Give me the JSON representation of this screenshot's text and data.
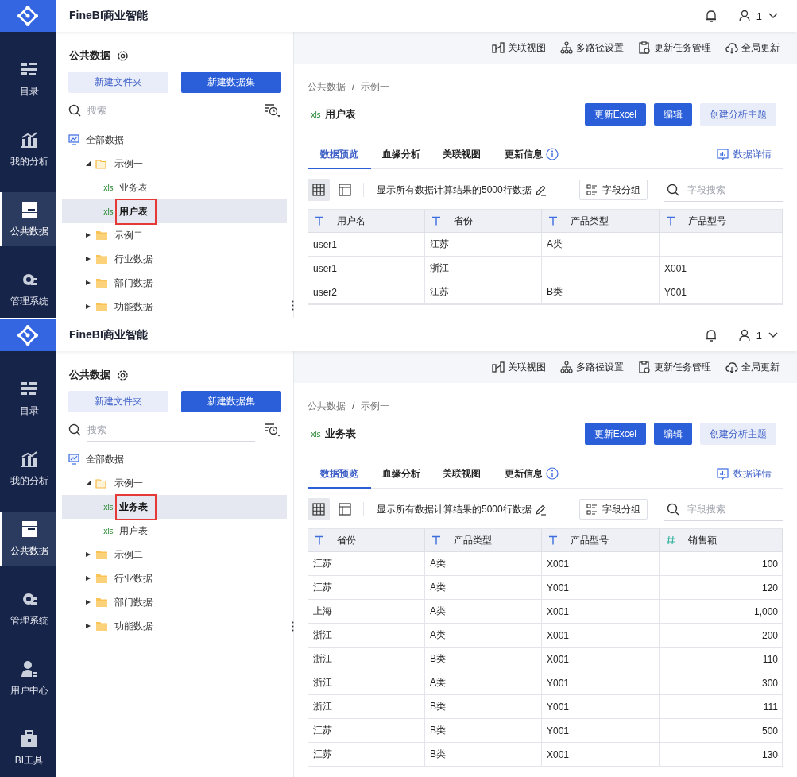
{
  "screens": [
    {
      "app": {
        "title": "FineBI商业智能",
        "user": "1"
      },
      "nav": [
        {
          "label": "目录",
          "kind": "catalog",
          "selected": false
        },
        {
          "label": "我的分析",
          "kind": "analysis",
          "selected": false
        },
        {
          "label": "公共数据",
          "kind": "public",
          "selected": true
        },
        {
          "label": "管理系统",
          "kind": "admin",
          "selected": false
        }
      ],
      "panel": {
        "title": "公共数据",
        "buttons": [
          {
            "label": "新建文件夹",
            "kind": "secondary"
          },
          {
            "label": "新建数据集",
            "kind": "primary"
          }
        ],
        "search": {
          "placeholder": "搜索"
        }
      },
      "tree": [
        {
          "label": "全部数据",
          "kind": "root",
          "children": [
            {
              "label": "示例一",
              "kind": "folder",
              "expanded": true,
              "children": [
                {
                  "label": "业务表",
                  "kind": "table",
                  "badge": "xls",
                  "selected": false
                },
                {
                  "label": "用户表",
                  "kind": "table",
                  "badge": "xls",
                  "selected": true
                }
              ]
            },
            {
              "label": "示例二",
              "kind": "folder",
              "expanded": false
            },
            {
              "label": "行业数据",
              "kind": "folder",
              "expanded": false
            },
            {
              "label": "部门数据",
              "kind": "folder",
              "expanded": false
            },
            {
              "label": "功能数据",
              "kind": "folder",
              "expanded": false
            }
          ]
        }
      ],
      "toolbar": [
        {
          "label": "关联视图",
          "kind": "relation"
        },
        {
          "label": "多路径设置",
          "kind": "paths"
        },
        {
          "label": "更新任务管理",
          "kind": "tasks"
        },
        {
          "label": "全局更新",
          "kind": "cloud"
        }
      ],
      "breadcrumb": {
        "items": [
          "公共数据",
          "示例一"
        ],
        "separator": "/"
      },
      "dataset": {
        "badge": "xls",
        "name": "用户表"
      },
      "actions": [
        {
          "label": "更新Excel",
          "kind": "primary"
        },
        {
          "label": "编辑",
          "kind": "primary"
        },
        {
          "label": "创建分析主题",
          "kind": "secondary"
        }
      ],
      "tabs": [
        {
          "label": "数据预览",
          "selected": true,
          "info": false
        },
        {
          "label": "血缘分析",
          "selected": false,
          "info": false
        },
        {
          "label": "关联视图",
          "selected": false,
          "info": false
        },
        {
          "label": "更新信息",
          "selected": false,
          "info": true
        }
      ],
      "detail_link": "数据详情",
      "view_modes": [
        {
          "kind": "grid",
          "selected": true
        },
        {
          "kind": "layout",
          "selected": false
        }
      ],
      "row_info": "显示所有数据计算结果的5000行数据",
      "group_button": "字段分组",
      "field_search": {
        "placeholder": "字段搜索"
      },
      "table": {
        "columns": [
          {
            "label": "用户名",
            "kind": "text"
          },
          {
            "label": "省份",
            "kind": "text"
          },
          {
            "label": "产品类型",
            "kind": "text"
          },
          {
            "label": "产品型号",
            "kind": "text"
          }
        ],
        "rows": [
          [
            "user1",
            "江苏",
            "A类",
            null
          ],
          [
            "user1",
            "浙江",
            null,
            "X001"
          ],
          [
            "user2",
            "江苏",
            "B类",
            "Y001"
          ]
        ]
      }
    },
    {
      "app": {
        "title": "FineBI商业智能",
        "user": "1"
      },
      "nav": [
        {
          "label": "目录",
          "kind": "catalog",
          "selected": false
        },
        {
          "label": "我的分析",
          "kind": "analysis",
          "selected": false
        },
        {
          "label": "公共数据",
          "kind": "public",
          "selected": true
        },
        {
          "label": "管理系统",
          "kind": "admin",
          "selected": false
        },
        {
          "label": "用户中心",
          "kind": "user",
          "selected": false
        },
        {
          "label": "BI工具",
          "kind": "tools",
          "selected": false
        }
      ],
      "panel": {
        "title": "公共数据",
        "buttons": [
          {
            "label": "新建文件夹",
            "kind": "secondary"
          },
          {
            "label": "新建数据集",
            "kind": "primary"
          }
        ],
        "search": {
          "placeholder": "搜索"
        }
      },
      "tree": [
        {
          "label": "全部数据",
          "kind": "root",
          "children": [
            {
              "label": "示例一",
              "kind": "folder",
              "expanded": true,
              "children": [
                {
                  "label": "业务表",
                  "kind": "table",
                  "badge": "xls",
                  "selected": true
                },
                {
                  "label": "用户表",
                  "kind": "table",
                  "badge": "xls",
                  "selected": false
                }
              ]
            },
            {
              "label": "示例二",
              "kind": "folder",
              "expanded": false
            },
            {
              "label": "行业数据",
              "kind": "folder",
              "expanded": false
            },
            {
              "label": "部门数据",
              "kind": "folder",
              "expanded": false
            },
            {
              "label": "功能数据",
              "kind": "folder",
              "expanded": false
            }
          ]
        }
      ],
      "toolbar": [
        {
          "label": "关联视图",
          "kind": "relation"
        },
        {
          "label": "多路径设置",
          "kind": "paths"
        },
        {
          "label": "更新任务管理",
          "kind": "tasks"
        },
        {
          "label": "全局更新",
          "kind": "cloud"
        }
      ],
      "breadcrumb": {
        "items": [
          "公共数据",
          "示例一"
        ],
        "separator": "/"
      },
      "dataset": {
        "badge": "xls",
        "name": "业务表"
      },
      "actions": [
        {
          "label": "更新Excel",
          "kind": "primary"
        },
        {
          "label": "编辑",
          "kind": "primary"
        },
        {
          "label": "创建分析主题",
          "kind": "secondary"
        }
      ],
      "tabs": [
        {
          "label": "数据预览",
          "selected": true,
          "info": false
        },
        {
          "label": "血缘分析",
          "selected": false,
          "info": false
        },
        {
          "label": "关联视图",
          "selected": false,
          "info": false
        },
        {
          "label": "更新信息",
          "selected": false,
          "info": true
        }
      ],
      "detail_link": "数据详情",
      "view_modes": [
        {
          "kind": "grid",
          "selected": true
        },
        {
          "kind": "layout",
          "selected": false
        }
      ],
      "row_info": "显示所有数据计算结果的5000行数据",
      "group_button": "字段分组",
      "field_search": {
        "placeholder": "字段搜索"
      },
      "table": {
        "columns": [
          {
            "label": "省份",
            "kind": "text"
          },
          {
            "label": "产品类型",
            "kind": "text"
          },
          {
            "label": "产品型号",
            "kind": "text"
          },
          {
            "label": "销售额",
            "kind": "number"
          }
        ],
        "rows": [
          [
            "江苏",
            "A类",
            "X001",
            "100"
          ],
          [
            "江苏",
            "A类",
            "Y001",
            "120"
          ],
          [
            "上海",
            "A类",
            "X001",
            "1,000"
          ],
          [
            "浙江",
            "A类",
            "X001",
            "200"
          ],
          [
            "浙江",
            "B类",
            "X001",
            "110"
          ],
          [
            "浙江",
            "A类",
            "Y001",
            "300"
          ],
          [
            "浙江",
            "B类",
            "Y001",
            "111"
          ],
          [
            "江苏",
            "B类",
            "Y001",
            "500"
          ],
          [
            "江苏",
            "B类",
            "X001",
            "130"
          ]
        ]
      }
    }
  ]
}
